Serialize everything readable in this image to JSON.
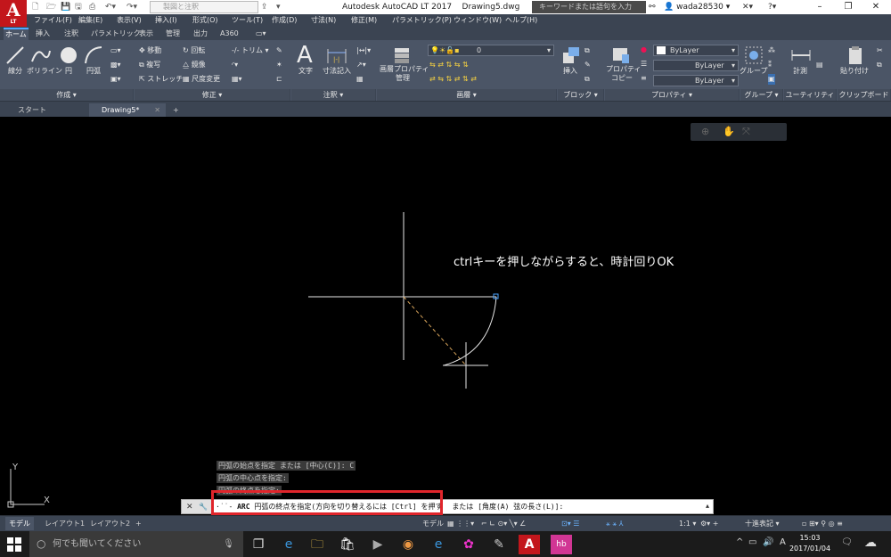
{
  "colors": {
    "accent": "#c3161c",
    "ribbon": "#4b5566",
    "menubar": "#3b4452",
    "highlight": "#e0252b",
    "canvas": "#000000"
  },
  "titlebar": {
    "logo_text": "A",
    "logo_sub": "LT",
    "workspace": "製図と注釈",
    "title": "Autodesk AutoCAD LT 2017    Drawing5.dwg",
    "search_placeholder": "キーワードまたは語句を入力",
    "user": "wada28530"
  },
  "menu": [
    "ファイル(F)",
    "編集(E)",
    "表示(V)",
    "挿入(I)",
    "形式(O)",
    "ツール(T)",
    "作成(D)",
    "寸法(N)",
    "修正(M)",
    "パラメトリック(P)",
    "ウィンドウ(W)",
    "ヘルプ(H)"
  ],
  "ribbon_tabs": [
    "ホーム",
    "挿入",
    "注釈",
    "パラメトリック",
    "表示",
    "管理",
    "出力",
    "A360"
  ],
  "ribbon": {
    "draw": {
      "line": "線分",
      "polyline": "ポリライン",
      "circle": "円",
      "arc": "円弧",
      "panel": "作成 ▾"
    },
    "modify": {
      "move": "移動",
      "rotate": "回転",
      "trim": "トリム ▾",
      "copy": "複写",
      "mirror": "鏡像",
      "stretch": "ストレッチ",
      "scale": "尺度変更",
      "panel": "修正 ▾"
    },
    "annotation": {
      "text": "文字",
      "dimension": "寸法記入",
      "panel": "注釈 ▾"
    },
    "layers": {
      "properties_line1": "画層プロパティ",
      "properties_line2": "管理",
      "layer_value": "0",
      "panel": "画層 ▾"
    },
    "block": {
      "insert": "挿入",
      "panel": "ブロック ▾"
    },
    "properties": {
      "match_line1": "プロパティ",
      "match_line2": "コピー",
      "color": "ByLayer",
      "linetype": "ByLayer",
      "lineweight": "ByLayer",
      "panel": "プロパティ ▾"
    },
    "groups": {
      "group": "グループ",
      "panel": "グループ ▾"
    },
    "utilities": {
      "measure": "計測",
      "panel": "ユーティリティ ▾"
    },
    "clipboard": {
      "paste": "貼り付け",
      "panel": "クリップボード"
    }
  },
  "file_tabs": {
    "start": "スタート",
    "drawing": "Drawing5*",
    "close": "✕",
    "add": "+"
  },
  "annotation_text": "ctrlキーを押しながらすると、時計回りOK",
  "command_history": [
    "円弧の始点を指定 または [中心(C)]: C",
    "円弧の中心点を指定:",
    "円弧の終点を指定:"
  ],
  "command_line": {
    "close": "✕",
    "tool": "🔧",
    "prompt_cmd": "ARC",
    "prompt_text": "円弧の終点を指定(方向を切り替えるには [Ctrl] を押す",
    "prompt_suffix": "または [角度(A) 弦の長さ(L)]:",
    "scroll": "▴"
  },
  "layout_tabs": [
    "モデル",
    "レイアウト1",
    "レイアウト2",
    "+"
  ],
  "statusbar": {
    "model": "モデル",
    "scale": "1:1 ▾",
    "units": "十進表記 ▾"
  },
  "taskbar": {
    "search_placeholder": "何でも聞いてください",
    "time": "15:03",
    "date": "2017/01/04",
    "ime": "A"
  }
}
